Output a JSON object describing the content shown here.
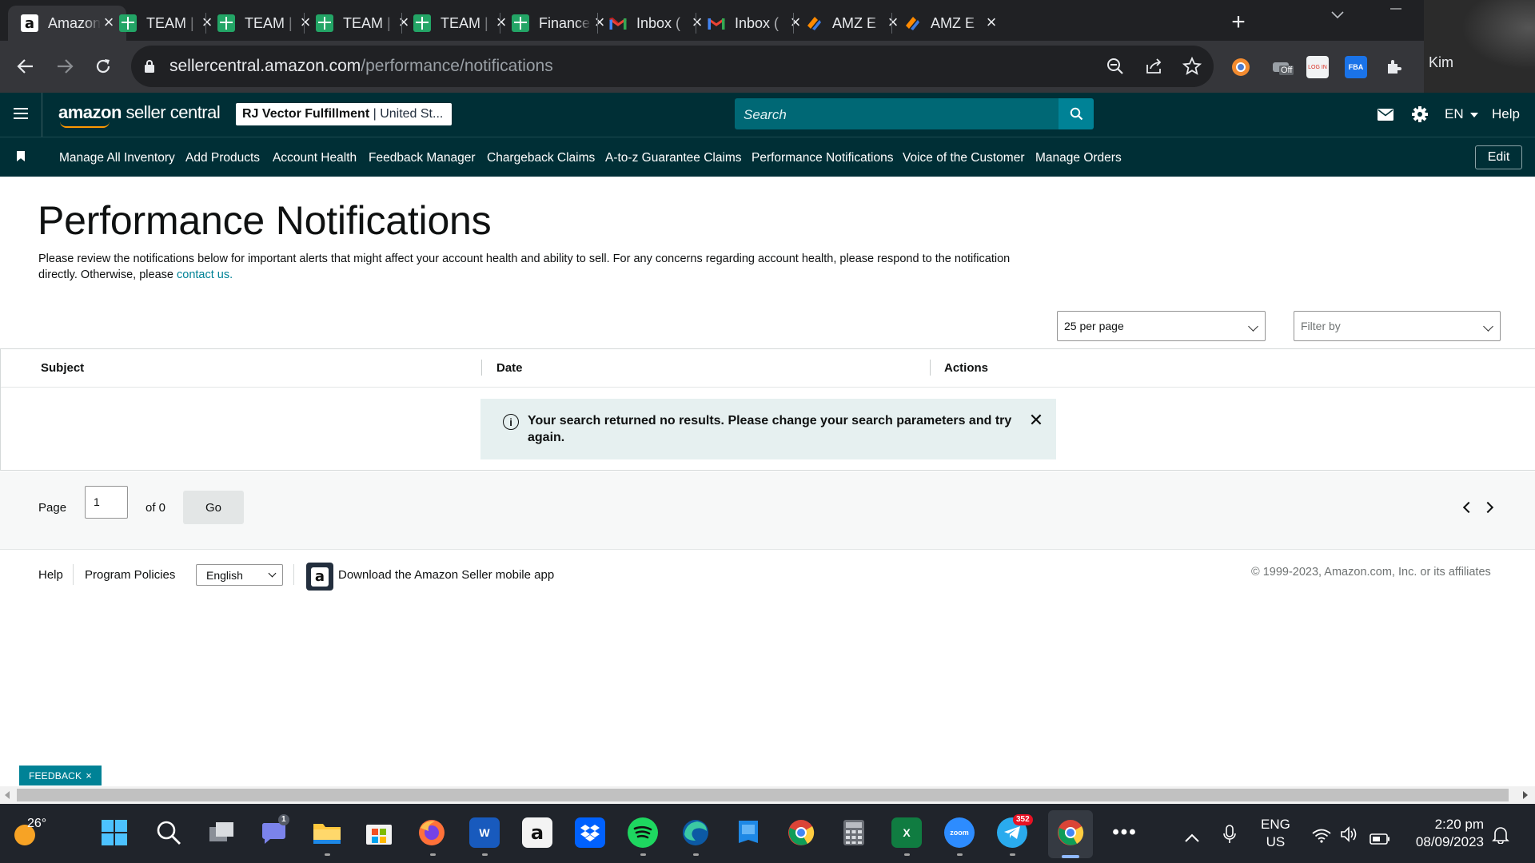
{
  "browser": {
    "tabs": [
      {
        "label": "Amazon",
        "favicon": "amazon-icon",
        "active": true
      },
      {
        "label": "TEAM |",
        "favicon": "sheets-icon"
      },
      {
        "label": "TEAM |",
        "favicon": "sheets-icon"
      },
      {
        "label": "TEAM |",
        "favicon": "sheets-icon"
      },
      {
        "label": "TEAM |",
        "favicon": "sheets-icon"
      },
      {
        "label": "Finance",
        "favicon": "sheets-icon"
      },
      {
        "label": "Inbox (",
        "favicon": "gmail-icon"
      },
      {
        "label": "Inbox (",
        "favicon": "gmail-icon"
      },
      {
        "label": "AMZ E",
        "favicon": "amz-e-icon"
      },
      {
        "label": "AMZ E",
        "favicon": "amz-e-icon"
      }
    ],
    "profile_name": "Kim",
    "url_host": "sellercentral.amazon.com",
    "url_path": "/performance/notifications",
    "extension_off_label": "Off"
  },
  "header": {
    "logo_bold": "amazon",
    "logo_rest": " seller central",
    "store_name": "RJ Vector Fulfillment",
    "store_region": " | United St...",
    "search_placeholder": "Search",
    "language": "EN",
    "help": "Help"
  },
  "nav": {
    "items": [
      "Manage All Inventory",
      "Add Products",
      "Account Health",
      "Feedback Manager",
      "Chargeback Claims",
      "A-to-z Guarantee Claims",
      "Performance Notifications",
      "Voice of the Customer",
      "Manage Orders"
    ],
    "edit": "Edit"
  },
  "main": {
    "title": "Performance Notifications",
    "intro_text": "Please review the notifications below for important alerts that might affect your account health and ability to sell. For any concerns regarding account health, please respond to the notification directly. Otherwise, please ",
    "intro_link": "contact us.",
    "per_page": "25 per page",
    "filter_placeholder": "Filter by",
    "columns": [
      "Subject",
      "Date",
      "Actions"
    ],
    "alert_message": "Your search returned no results. Please change your search parameters and try again.",
    "pager": {
      "page_label": "Page",
      "page_value": "1",
      "of_label": "of 0",
      "go_label": "Go"
    }
  },
  "footer": {
    "help": "Help",
    "program_policies": "Program Policies",
    "language": "English",
    "app_download": "Download the Amazon Seller mobile app",
    "copyright": "© 1999-2023, Amazon.com, Inc. or its affiliates",
    "feedback": "FEEDBACK"
  },
  "taskbar": {
    "temperature": "26°",
    "teams_badge": "1",
    "telegram_badge": "352",
    "input_lang_1": "ENG",
    "input_lang_2": "US",
    "time": "2:20 pm",
    "date": "08/09/2023"
  },
  "colors": {
    "header_bg": "#002f36",
    "accent_teal": "#008296",
    "alert_bg": "#e6f0f0"
  }
}
